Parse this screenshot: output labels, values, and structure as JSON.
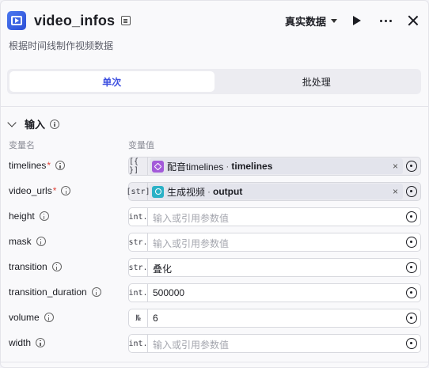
{
  "header": {
    "title": "video_infos",
    "data_mode": "真实数据",
    "subtitle": "根据时间线制作视频数据"
  },
  "tabs": [
    {
      "label": "单次",
      "active": true
    },
    {
      "label": "批处理",
      "active": false
    }
  ],
  "section": {
    "title": "输入",
    "col_name": "变量名",
    "col_value": "变量值"
  },
  "params": [
    {
      "name": "timelines",
      "required": "*",
      "type": "[{ }]",
      "ref_node": "配音timelines",
      "ref_sep": "·",
      "ref_output": "timelines",
      "remove": "×"
    },
    {
      "name": "video_urls",
      "required": "*",
      "type": "[str]",
      "ref_node": "生成视频",
      "ref_sep": "·",
      "ref_output": "output",
      "remove": "×"
    },
    {
      "name": "height",
      "type": "int.",
      "placeholder": "输入或引用参数值"
    },
    {
      "name": "mask",
      "type": "str.",
      "placeholder": "输入或引用参数值"
    },
    {
      "name": "transition",
      "type": "str.",
      "value": "叠化"
    },
    {
      "name": "transition_duration",
      "type": "int.",
      "value": "500000"
    },
    {
      "name": "volume",
      "type": "№",
      "value": "6"
    },
    {
      "name": "width",
      "type": "int.",
      "placeholder": "输入或引用参数值"
    }
  ],
  "colors": {
    "accent": "#3f51e0",
    "required": "#e2453c",
    "node_purple": "#a35ad9",
    "node_teal": "#2bb1c6"
  }
}
